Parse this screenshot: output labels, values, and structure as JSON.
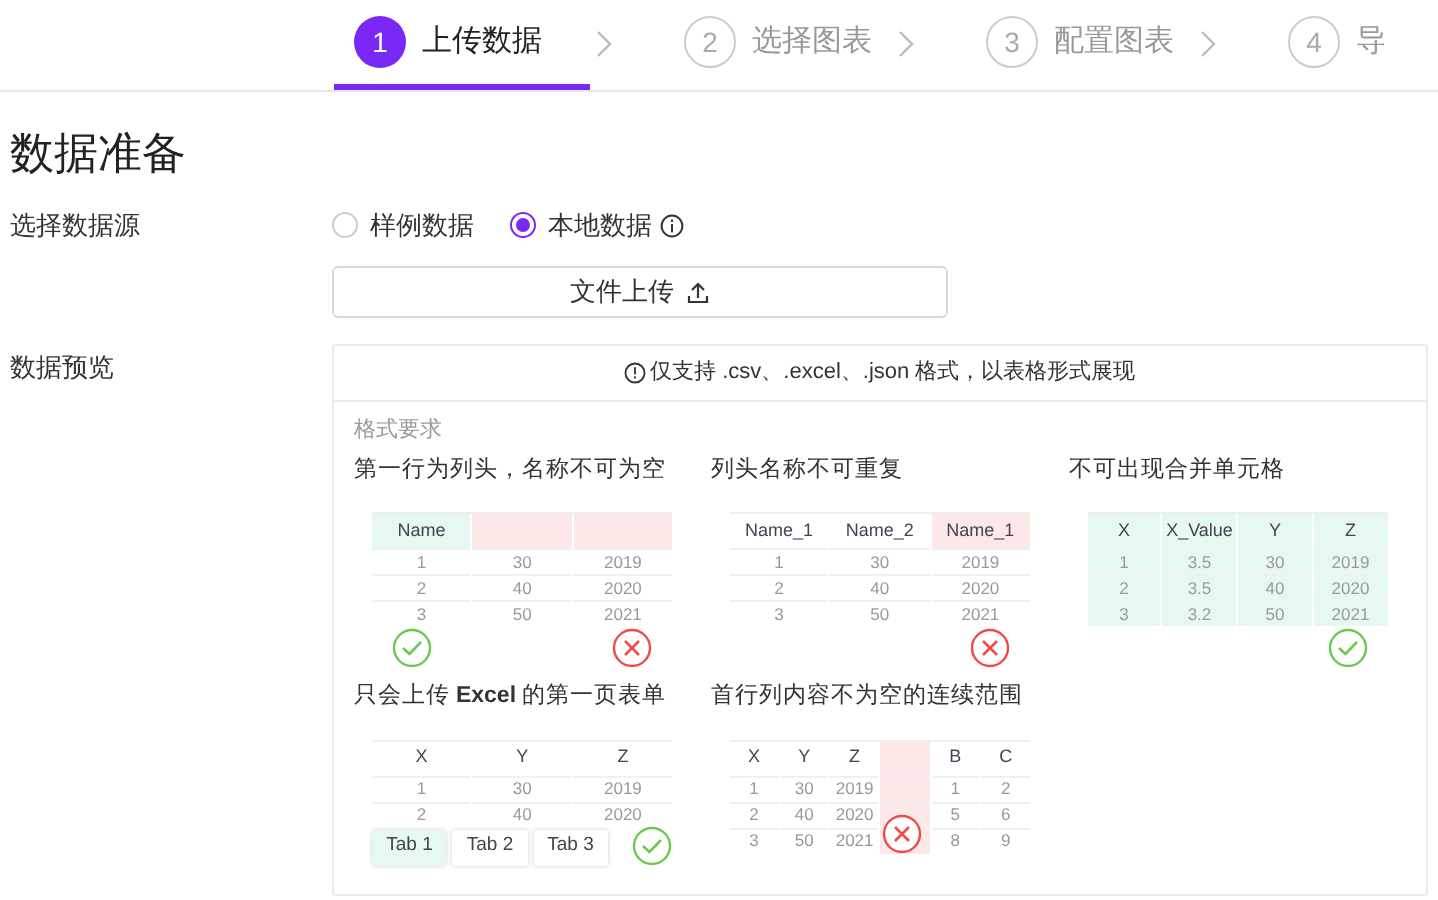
{
  "steps": [
    {
      "number": "1",
      "label": "上传数据",
      "selected": true
    },
    {
      "number": "2",
      "label": "选择图表",
      "selected": false
    },
    {
      "number": "3",
      "label": "配置图表",
      "selected": false
    },
    {
      "number": "4",
      "label": "导",
      "selected": false
    }
  ],
  "page_title": "数据准备",
  "source": {
    "label": "选择数据源",
    "options": [
      {
        "label": "样例数据",
        "selected": false
      },
      {
        "label": "本地数据",
        "selected": true,
        "info": true
      }
    ]
  },
  "upload_button": "文件上传",
  "preview": {
    "label": "数据预览",
    "note": "仅支持 .csv、.excel、.json 格式，以表格形式展现",
    "requirements_title": "格式要求",
    "examples": [
      {
        "title": "第一行为列头，名称不可为空",
        "checks": [
          {
            "passed": true
          },
          {
            "passed": false
          }
        ],
        "columns": [
          {
            "label": "Name",
            "color": "#e6f8ef"
          },
          {
            "color": "#fde8e8"
          },
          {
            "color": "#fde8e8"
          }
        ],
        "rows": [
          [
            "1",
            "30",
            "2019"
          ],
          [
            "2",
            "40",
            "2020"
          ],
          [
            "3",
            "50",
            "2021"
          ]
        ]
      },
      {
        "title": "列头名称不可重复",
        "checks": [
          {
            "passed": false
          }
        ],
        "columns": [
          {
            "label": "Name_1"
          },
          {
            "label": "Name_2"
          },
          {
            "label": "Name_1",
            "color": "#fde8e8"
          }
        ],
        "rows": [
          [
            "1",
            "30",
            "2019"
          ],
          [
            "2",
            "40",
            "2020"
          ],
          [
            "3",
            "50",
            "2021"
          ]
        ]
      },
      {
        "title": "不可出现合并单元格",
        "checks": [
          {
            "passed": true
          }
        ],
        "columns": [
          {
            "label": "X",
            "color": "#e6f8ef",
            "full": true
          },
          {
            "label": "X_Value",
            "color": "#e6f8ef",
            "full": true
          },
          {
            "label": "Y",
            "color": "#e6f8ef",
            "full": true
          },
          {
            "label": "Z",
            "color": "#e6f8ef",
            "full": true
          }
        ],
        "rows": [
          [
            "1",
            "3.5",
            "30",
            "2019"
          ],
          [
            "2",
            "3.5",
            "40",
            "2020"
          ],
          [
            "3",
            "3.2",
            "50",
            "2021"
          ]
        ]
      },
      {
        "title": "只会上传 **Excel** 的第一页表单",
        "checks": [
          {
            "passed": true
          }
        ],
        "columns": [
          {
            "label": "X"
          },
          {
            "label": "Y"
          },
          {
            "label": "Z"
          }
        ],
        "rows": [
          [
            "1",
            "30",
            "2019"
          ],
          [
            "2",
            "40",
            "2020"
          ]
        ],
        "sheet_tabs": [
          {
            "label": "Tab 1",
            "selected": true
          },
          {
            "label": "Tab 2",
            "selected": false
          },
          {
            "label": "Tab 3",
            "selected": false
          }
        ]
      },
      {
        "title": "首行列内容不为空的连续范围",
        "checks": [
          {
            "passed": false
          }
        ],
        "columns": [
          {
            "label": "X"
          },
          {
            "label": "Y"
          },
          {
            "label": "Z"
          },
          {
            "color": "#fde8e8",
            "full": true
          },
          {
            "label": "B"
          },
          {
            "label": "C"
          }
        ],
        "rows": [
          [
            "1",
            "30",
            "2019",
            null,
            "1",
            "2"
          ],
          [
            "2",
            "40",
            "2020",
            null,
            "5",
            "6"
          ],
          [
            "3",
            "50",
            "2021",
            null,
            "8",
            "9"
          ]
        ]
      }
    ]
  }
}
